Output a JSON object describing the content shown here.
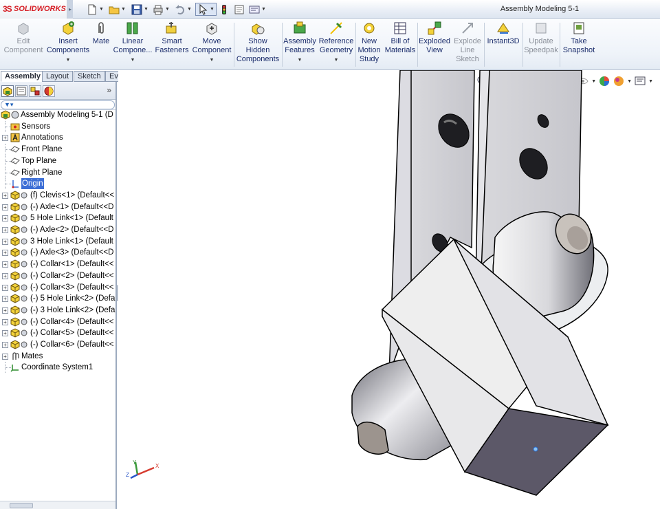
{
  "app": {
    "logo_mark": "3S",
    "logo_text": "SOLIDWORKS",
    "window_title": "Assembly Modeling 5-1"
  },
  "quick_access": [
    {
      "icon": "new-document-icon"
    },
    {
      "icon": "open-folder-icon"
    },
    {
      "icon": "save-icon"
    },
    {
      "icon": "print-icon"
    },
    {
      "icon": "undo-icon"
    },
    {
      "icon": "select-cursor-icon"
    },
    {
      "icon": "rebuild-traffic-light-icon"
    },
    {
      "icon": "file-properties-icon"
    },
    {
      "icon": "options-icon"
    }
  ],
  "ribbon": {
    "edit_component": "Edit\nComponent",
    "insert_components": "Insert\nComponents",
    "mate": "Mate",
    "linear_component": "Linear\nCompone...",
    "smart_fasteners": "Smart\nFasteners",
    "move_component": "Move\nComponent",
    "show_hidden": "Show\nHidden\nComponents",
    "assembly_features": "Assembly\nFeatures",
    "reference_geometry": "Reference\nGeometry",
    "new_motion_study": "New\nMotion\nStudy",
    "bill_of_materials": "Bill of\nMaterials",
    "exploded_view": "Exploded\nView",
    "explode_line_sketch": "Explode\nLine\nSketch",
    "instant3d": "Instant3D",
    "update_speedpak": "Update\nSpeedpak",
    "take_snapshot": "Take\nSnapshot"
  },
  "command_tabs": [
    "Assembly",
    "Layout",
    "Sketch",
    "Evaluate"
  ],
  "tree": {
    "root": "Assembly Modeling 5-1  (D",
    "items": [
      {
        "label": "Sensors",
        "icon": "sensors-folder-icon"
      },
      {
        "label": "Annotations",
        "icon": "annotations-icon"
      },
      {
        "label": "Front Plane",
        "icon": "plane-icon"
      },
      {
        "label": "Top Plane",
        "icon": "plane-icon"
      },
      {
        "label": "Right Plane",
        "icon": "plane-icon"
      },
      {
        "label": "Origin",
        "icon": "origin-icon"
      },
      {
        "label": "(f) Clevis<1> (Default<<",
        "icon": "part-icon"
      },
      {
        "label": "(-) Axle<1> (Default<<D",
        "icon": "part-icon"
      },
      {
        "label": "5 Hole Link<1> (Default",
        "icon": "part-icon"
      },
      {
        "label": "(-) Axle<2> (Default<<D",
        "icon": "part-icon"
      },
      {
        "label": "3 Hole Link<1> (Default",
        "icon": "part-icon"
      },
      {
        "label": "(-) Axle<3> (Default<<D",
        "icon": "part-icon"
      },
      {
        "label": "(-) Collar<1> (Default<<",
        "icon": "part-icon"
      },
      {
        "label": "(-) Collar<2> (Default<<",
        "icon": "part-icon"
      },
      {
        "label": "(-) Collar<3> (Default<<",
        "icon": "part-icon"
      },
      {
        "label": "(-) 5 Hole Link<2> (Defa",
        "icon": "part-icon"
      },
      {
        "label": "(-) 3 Hole Link<2> (Defa",
        "icon": "part-icon"
      },
      {
        "label": "(-) Collar<4> (Default<<",
        "icon": "part-icon"
      },
      {
        "label": "(-) Collar<5> (Default<<",
        "icon": "part-icon"
      },
      {
        "label": "(-) Collar<6> (Default<<",
        "icon": "part-icon"
      },
      {
        "label": "Mates",
        "icon": "mates-icon"
      },
      {
        "label": "Coordinate System1",
        "icon": "coordinate-system-icon"
      }
    ]
  },
  "triad": {
    "x": "X",
    "y": "Y",
    "z": "Z"
  },
  "colors": {
    "accent": "#3d6fd6",
    "brand_red": "#d61f26",
    "ribbon_text": "#1a2c6b"
  }
}
